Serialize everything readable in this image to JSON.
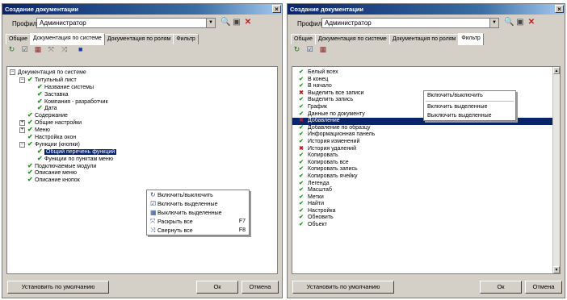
{
  "left": {
    "title": "Создание документации",
    "profile_label": "Профиль:",
    "profile_value": "Администратор",
    "tabs": [
      "Общие",
      "Документация по системе",
      "Документация по ролям",
      "Фильтр"
    ],
    "tree": [
      {
        "text": "Документация по системе",
        "exp": "−",
        "level": 0,
        "check": ""
      },
      {
        "text": "Титульный лист",
        "exp": "−",
        "level": 1,
        "check": "ok"
      },
      {
        "text": "Название системы",
        "exp": "",
        "level": 2,
        "check": "ok"
      },
      {
        "text": "Заставка",
        "exp": "",
        "level": 2,
        "check": "ok"
      },
      {
        "text": "Компания - разработчик",
        "exp": "",
        "level": 2,
        "check": "ok"
      },
      {
        "text": "Дата",
        "exp": "",
        "level": 2,
        "check": "ok"
      },
      {
        "text": "Содержание",
        "exp": "",
        "level": 1,
        "check": "ok"
      },
      {
        "text": "Общие настройки",
        "exp": "+",
        "level": 1,
        "check": "ok"
      },
      {
        "text": "Меню",
        "exp": "+",
        "level": 1,
        "check": "ok"
      },
      {
        "text": "Настройка окон",
        "exp": "",
        "level": 1,
        "check": "ok"
      },
      {
        "text": "Функции (кнопки)",
        "exp": "−",
        "level": 1,
        "check": "ok"
      },
      {
        "text": "Общий перечень функций",
        "exp": "",
        "level": 2,
        "check": "ok",
        "selected": true
      },
      {
        "text": "Функции по пунктам меню",
        "exp": "",
        "level": 2,
        "check": "ok"
      },
      {
        "text": "Подключаемые модули",
        "exp": "",
        "level": 1,
        "check": "ok"
      },
      {
        "text": "Описание меню",
        "exp": "",
        "level": 1,
        "check": "ok"
      },
      {
        "text": "Описание кнопок",
        "exp": "",
        "level": 1,
        "check": "ok"
      }
    ],
    "context_menu": [
      {
        "label": "Включить/выключить",
        "hotkey": "",
        "icon": "toggle-icon"
      },
      {
        "label": "Включить выделенные",
        "hotkey": "",
        "icon": "check-selected-icon"
      },
      {
        "label": "Выключить выделенные",
        "hotkey": "",
        "icon": "uncheck-selected-icon"
      },
      {
        "label": "Раскрыть все",
        "hotkey": "F7",
        "icon": "expand-all-icon"
      },
      {
        "label": "Свернуть все",
        "hotkey": "F8",
        "icon": "collapse-all-icon"
      }
    ],
    "btn_default": "Установить по умолчанию",
    "btn_ok": "Ок",
    "btn_cancel": "Отмена"
  },
  "right": {
    "title": "Создание документации",
    "profile_label": "Профиль:",
    "profile_value": "Администратор",
    "tabs": [
      "Общие",
      "Документация по системе",
      "Документация по ролям",
      "Фильтр"
    ],
    "list": [
      {
        "text": "Белый всех",
        "check": "ok"
      },
      {
        "text": "В конец",
        "check": "ok"
      },
      {
        "text": "В начало",
        "check": "ok"
      },
      {
        "text": "Выделить все записи",
        "check": "no"
      },
      {
        "text": "Выделить запись",
        "check": "ok"
      },
      {
        "text": "График",
        "check": "ok"
      },
      {
        "text": "Данные по документу",
        "check": "ok"
      },
      {
        "text": "Добавление",
        "check": "no",
        "selected": true
      },
      {
        "text": "Добавление по образцу",
        "check": "ok"
      },
      {
        "text": "Информационная панель",
        "check": "ok"
      },
      {
        "text": "История изменений",
        "check": "ok"
      },
      {
        "text": "История удалений",
        "check": "no"
      },
      {
        "text": "Копировать",
        "check": "ok"
      },
      {
        "text": "Копировать все",
        "check": "ok"
      },
      {
        "text": "Копировать запись",
        "check": "ok"
      },
      {
        "text": "Копировать ячейку",
        "check": "ok"
      },
      {
        "text": "Легенда",
        "check": "ok"
      },
      {
        "text": "Масштаб",
        "check": "ok"
      },
      {
        "text": "Метки",
        "check": "ok"
      },
      {
        "text": "Найти",
        "check": "ok"
      },
      {
        "text": "Настройка",
        "check": "ok"
      },
      {
        "text": "Обновить",
        "check": "ok"
      },
      {
        "text": "Объект",
        "check": "ok"
      }
    ],
    "context_menu": [
      {
        "label": "Включить/выключить"
      },
      {
        "label": "Включить выделенные"
      },
      {
        "label": "Выключить выделенные"
      }
    ],
    "btn_default": "Установить по умолчанию",
    "btn_ok": "Ок",
    "btn_cancel": "Отмена"
  }
}
